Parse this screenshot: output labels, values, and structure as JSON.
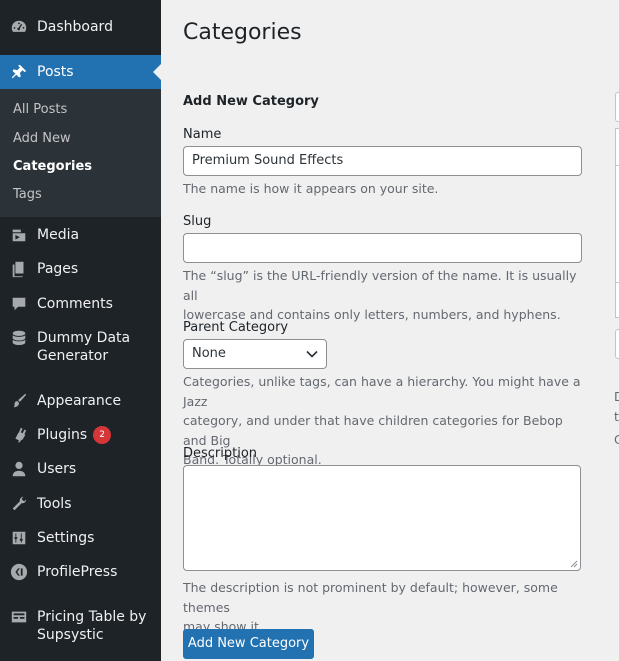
{
  "sidebar": {
    "items": [
      {
        "label": "Dashboard",
        "icon": "dashboard-icon"
      },
      {
        "label": "Posts",
        "icon": "pin-icon"
      },
      {
        "label": "Media",
        "icon": "media-icon"
      },
      {
        "label": "Pages",
        "icon": "pages-icon"
      },
      {
        "label": "Comments",
        "icon": "comments-icon"
      },
      {
        "label": "Dummy Data",
        "label2": "Generator",
        "icon": "database-icon"
      },
      {
        "label": "Appearance",
        "icon": "brush-icon"
      },
      {
        "label": "Plugins",
        "icon": "plugin-icon",
        "badge": "2"
      },
      {
        "label": "Users",
        "icon": "user-icon"
      },
      {
        "label": "Tools",
        "icon": "wrench-icon"
      },
      {
        "label": "Settings",
        "icon": "sliders-icon"
      },
      {
        "label": "ProfilePress",
        "icon": "profilepress-icon"
      },
      {
        "label": "Pricing Table by",
        "label2": "Supsystic",
        "icon": "pricing-table-icon"
      }
    ],
    "submenu": [
      "All Posts",
      "Add New",
      "Categories",
      "Tags"
    ],
    "active_color": "#2271b1"
  },
  "page": {
    "title": "Categories"
  },
  "form": {
    "heading": "Add New Category",
    "name_label": "Name",
    "name_value": "Premium Sound Effects",
    "name_help": "The name is how it appears on your site.",
    "slug_label": "Slug",
    "slug_value": "",
    "slug_help_1": "The “slug” is the URL-friendly version of the name. It is usually all",
    "slug_help_2": "lowercase and contains only letters, numbers, and hyphens.",
    "parent_label": "Parent Category",
    "parent_value": "None",
    "parent_help_1": "Categories, unlike tags, can have a hierarchy. You might have a Jazz",
    "parent_help_2": "category, and under that have children categories for Bebop and Big",
    "parent_help_3": "Band. Totally optional.",
    "description_label": "Description",
    "description_help_1": "The description is not prominent by default; however, some themes",
    "description_help_2": "may show it.",
    "submit_label": "Add New Category"
  },
  "right_panel": {
    "fragments": [
      "D",
      "t",
      "C"
    ]
  }
}
